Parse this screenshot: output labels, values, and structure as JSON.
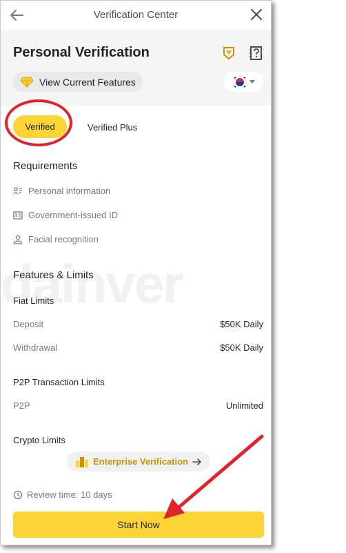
{
  "header": {
    "title": "Verification Center",
    "back_icon": "arrow-left-icon",
    "close_icon": "close-icon"
  },
  "hero": {
    "title": "Personal Verification",
    "features_label": "View Current Features",
    "country_flag": "south-korea-flag-icon"
  },
  "tabs": [
    {
      "label": "Verified",
      "active": true
    },
    {
      "label": "Verified Plus",
      "active": false
    }
  ],
  "requirements": {
    "title": "Requirements",
    "items": [
      {
        "label": "Personal information",
        "icon": "id-card-list-icon"
      },
      {
        "label": "Government-issued ID",
        "icon": "id-document-icon"
      },
      {
        "label": "Facial recognition",
        "icon": "person-icon"
      }
    ]
  },
  "features": {
    "title": "Features & Limits",
    "fiat": {
      "title": "Fiat Limits",
      "rows": [
        {
          "label": "Deposit",
          "value": "$50K Daily"
        },
        {
          "label": "Withdrawal",
          "value": "$50K Daily"
        }
      ]
    },
    "p2p": {
      "title": "P2P Transaction Limits",
      "rows": [
        {
          "label": "P2P",
          "value": "Unlimited"
        }
      ]
    },
    "crypto": {
      "title": "Crypto Limits"
    }
  },
  "enterprise_label": "Enterprise Verification",
  "review_time": "Review time: 10 days",
  "start_label": "Start Now",
  "colors": {
    "accent": "#fcd535",
    "annotation": "#e0242a",
    "enterprise_text": "#c99400"
  }
}
